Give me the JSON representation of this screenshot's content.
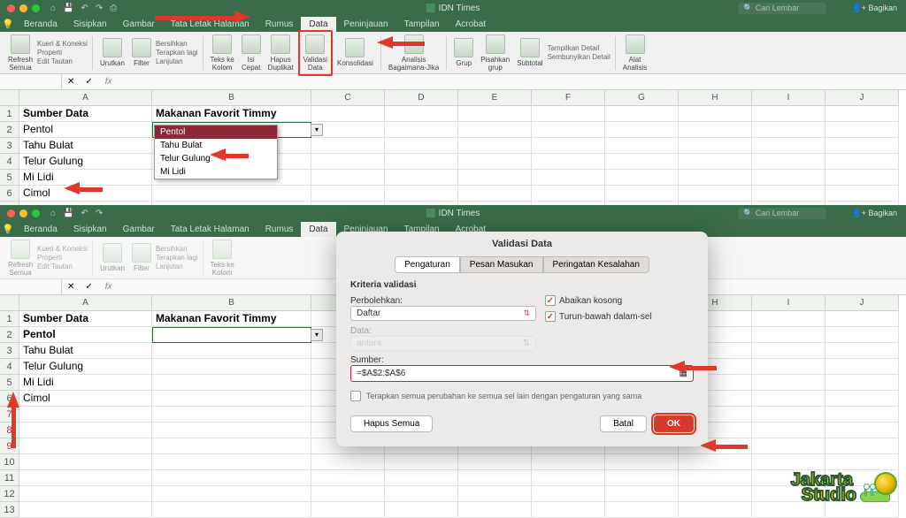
{
  "app": {
    "title": "IDN Times",
    "search_ph": "Cari Lembar",
    "share": "Bagikan"
  },
  "tabs": [
    "Beranda",
    "Sisipkan",
    "Gambar",
    "Tata Letak Halaman",
    "Rumus",
    "Data",
    "Peninjauan",
    "Tampilan",
    "Acrobat"
  ],
  "active_tab": "Data",
  "ribbon": {
    "refresh": "Refresh\nSemua",
    "kueri": "Kueri & Koneksi",
    "properti": "Properti",
    "edit": "Edit Tautan",
    "urutkan": "Urutkan",
    "filter": "Filter",
    "bersihkan": "Bersihkan",
    "terapkan": "Terapkan lagi",
    "lanjutan": "Lanjutan",
    "teks": "Teks ke\nKolom",
    "isi": "Isi\nCepat",
    "hapus": "Hapus\nDuplikat",
    "validasi": "Validasi\nData",
    "konsolidasi": "Konsolidasi",
    "analisis": "Analisis\nBagaimana-Jika",
    "grup": "Grup",
    "pisahkan": "Pisahkan\ngrup",
    "subtotal": "Subtotal",
    "tampilkan": "Tampilkan Detail",
    "sembunyikan": "Sembunyikan Detail",
    "alat": "Alat\nAnalisis"
  },
  "columns": [
    "A",
    "B",
    "C",
    "D",
    "E",
    "F",
    "G",
    "H",
    "I",
    "J"
  ],
  "rows1": {
    "h1": {
      "a": "Sumber Data",
      "b": "Makanan Favorit Timmy"
    },
    "r": [
      "Pentol",
      "Tahu Bulat",
      "Telur Gulung",
      "Mi Lidi",
      "Cimol"
    ]
  },
  "dropdown": {
    "items": [
      "Pentol",
      "Tahu Bulat",
      "Telur Gulung",
      "Mi Lidi"
    ],
    "selected": "Pentol"
  },
  "dialog": {
    "title": "Validasi Data",
    "tabs": [
      "Pengaturan",
      "Pesan Masukan",
      "Peringatan Kesalahan"
    ],
    "section": "Kriteria validasi",
    "perbolehkan_lbl": "Perbolehkan:",
    "perbolehkan_val": "Daftar",
    "data_lbl": "Data:",
    "data_val": "antara",
    "abaikan": "Abaikan kosong",
    "turun": "Turun-bawah dalam-sel",
    "sumber_lbl": "Sumber:",
    "sumber_val": "=$A$2:$A$6",
    "note": "Terapkan semua perubahan ke semua sel lain dengan pengaturan yang sama",
    "hapus": "Hapus Semua",
    "batal": "Batal",
    "ok": "OK"
  },
  "fx": "fx",
  "watermark": {
    "l1": "Jakarta",
    "l2": "Studio"
  }
}
